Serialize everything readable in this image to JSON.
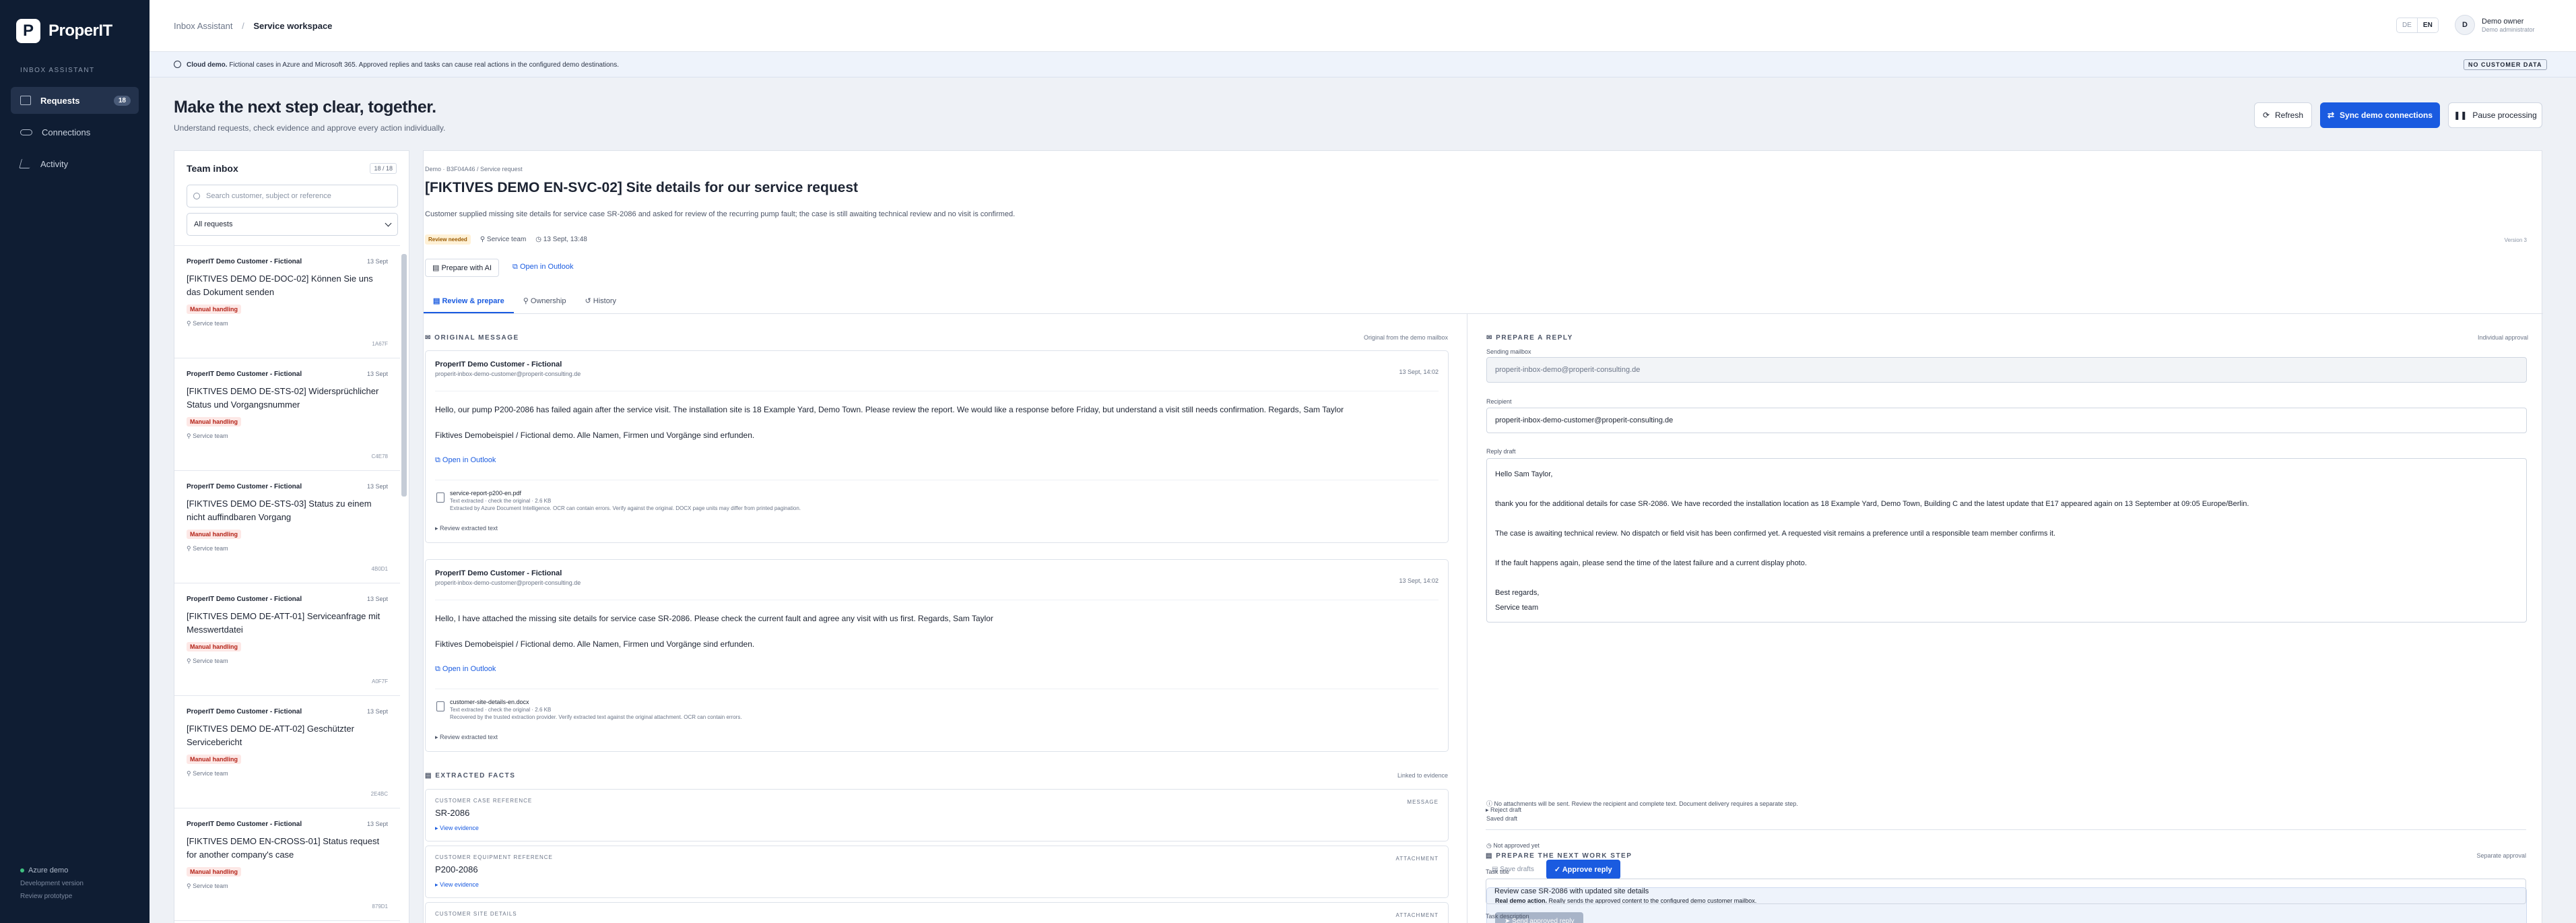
{
  "brand": {
    "mark": "P",
    "name": "ProperIT"
  },
  "nav": {
    "section_label": "INBOX ASSISTANT",
    "items": [
      {
        "label": "Requests",
        "badge": "18"
      },
      {
        "label": "Connections"
      },
      {
        "label": "Activity"
      }
    ],
    "footer": {
      "env": "Azure demo",
      "version": "Development version",
      "prototype": "Review prototype"
    }
  },
  "topbar": {
    "crumb_parent": "Inbox Assistant",
    "crumb_separator": "/",
    "crumb_current": "Service workspace",
    "lang_de": "DE",
    "lang_en": "EN",
    "user_initial": "D",
    "user_name": "Demo owner",
    "user_role": "Demo administrator"
  },
  "banner": {
    "strong": "Cloud demo.",
    "text": " Fictional cases in Azure and Microsoft 365. Approved replies and tasks can cause real actions in the configured demo destinations.",
    "tag": "NO CUSTOMER DATA"
  },
  "header": {
    "title": "Make the next step clear, together.",
    "subtitle": "Understand requests, check evidence and approve every action individually.",
    "refresh": "Refresh",
    "sync": "Sync demo connections",
    "pause": "Pause processing"
  },
  "inbox": {
    "title": "Team inbox",
    "count": "18 / 18",
    "search_placeholder": "Search customer, subject or reference",
    "filter": "All requests",
    "tickets": [
      {
        "customer": "ProperIT Demo Customer - Fictional",
        "date": "13 Sept",
        "title": "[FIKTIVES DEMO DE-DOC-02] Können Sie uns das Dokument senden",
        "badge": "Manual handling",
        "team": "Service team",
        "ref": "1A67F"
      },
      {
        "customer": "ProperIT Demo Customer - Fictional",
        "date": "13 Sept",
        "title": "[FIKTIVES DEMO DE-STS-02] Widersprüchlicher Status und Vorgangsnummer",
        "badge": "Manual handling",
        "team": "Service team",
        "ref": "C4E78"
      },
      {
        "customer": "ProperIT Demo Customer - Fictional",
        "date": "13 Sept",
        "title": "[FIKTIVES DEMO DE-STS-03] Status zu einem nicht auffindbaren Vorgang",
        "badge": "Manual handling",
        "team": "Service team",
        "ref": "4B0D1"
      },
      {
        "customer": "ProperIT Demo Customer - Fictional",
        "date": "13 Sept",
        "title": "[FIKTIVES DEMO DE-ATT-01] Serviceanfrage mit Messwertdatei",
        "badge": "Manual handling",
        "team": "Service team",
        "ref": "A0F7F"
      },
      {
        "customer": "ProperIT Demo Customer - Fictional",
        "date": "13 Sept",
        "title": "[FIKTIVES DEMO DE-ATT-02] Geschützter Servicebericht",
        "badge": "Manual handling",
        "team": "Service team",
        "ref": "2E4BC"
      },
      {
        "customer": "ProperIT Demo Customer - Fictional",
        "date": "13 Sept",
        "title": "[FIKTIVES DEMO EN-CROSS-01] Status request for another company's case",
        "badge": "Manual handling",
        "team": "Service team",
        "ref": "879D1"
      }
    ]
  },
  "detail": {
    "crumb": "Demo · B3F04A46  /  Service request",
    "title": "[FIKTIVES DEMO EN-SVC-02] Site details for our service request",
    "summary": "Customer supplied missing site details for service case SR-2086 and asked for review of the recurring pump fault; the case is still awaiting technical review and no visit is confirmed.",
    "status": "Review needed",
    "team": "Service team",
    "date": "13 Sept, 13:48",
    "version": "Version 3",
    "prepare_ai": "Prepare with AI",
    "open_outlook": "Open in Outlook",
    "tabs": [
      "Review & prepare",
      "Ownership",
      "History"
    ]
  },
  "original": {
    "heading": "ORIGINAL MESSAGE",
    "note": "Original from the demo mailbox",
    "messages": [
      {
        "from": "ProperIT Demo Customer - Fictional",
        "mail": "properit-inbox-demo-customer@properit-consulting.de",
        "date": "13 Sept, 14:02",
        "body": "Hello, our pump P200-2086 has failed again after the service visit. The installation site is 18 Example Yard, Demo Town. Please review the report. We would like a response before Friday, but understand a visit still needs confirmation. Regards, Sam Taylor",
        "body2": "Fiktives Demobeispiel / Fictional demo. Alle Namen, Firmen und Vorgänge sind erfunden.",
        "outlook": "Open in Outlook",
        "att_name": "service-report-p200-en.pdf",
        "att_note1": "Text extracted · check the original · 2.6 KB",
        "att_note2": "Extracted by Azure Document Intelligence. OCR can contain errors. Verify against the original. DOCX page units may differ from printed pagination.",
        "att_review": "▸  Review extracted text"
      },
      {
        "from": "ProperIT Demo Customer - Fictional",
        "mail": "properit-inbox-demo-customer@properit-consulting.de",
        "date": "13 Sept, 14:02",
        "body": "Hello, I have attached the missing site details for service case SR-2086. Please check the current fault and agree any visit with us first. Regards, Sam Taylor",
        "body2": "Fiktives Demobeispiel / Fictional demo. Alle Namen, Firmen und Vorgänge sind erfunden.",
        "outlook": "Open in Outlook",
        "att_name": "customer-site-details-en.docx",
        "att_note1": "Text extracted · check the original · 2.6 KB",
        "att_note2": "Recovered by the trusted extraction provider. Verify extracted text against the original attachment. OCR can contain errors.",
        "att_review": "▸  Review extracted text"
      }
    ]
  },
  "facts": {
    "heading": "EXTRACTED FACTS",
    "note": "Linked to evidence",
    "items": [
      {
        "label": "CUSTOMER CASE REFERENCE",
        "source": "MESSAGE",
        "value": "SR-2086",
        "evidence": "▸  View evidence"
      },
      {
        "label": "CUSTOMER EQUIPMENT REFERENCE",
        "source": "ATTACHMENT",
        "value": "P200-2086",
        "evidence": "▸  View evidence"
      },
      {
        "label": "CUSTOMER SITE DETAILS",
        "source": "ATTACHMENT",
        "value": "",
        "evidence": ""
      }
    ]
  },
  "reply": {
    "heading": "PREPARE A REPLY",
    "note": "Individual approval",
    "mailbox_label": "Sending mailbox",
    "mailbox": "properit-inbox-demo@properit-consulting.de",
    "recipient_label": "Recipient",
    "recipient": "properit-inbox-demo-customer@properit-consulting.de",
    "draft_label": "Reply draft",
    "draft": "Hello Sam Taylor,\n\nthank you for the additional details for case SR-2086. We have recorded the installation location as 18 Example Yard, Demo Town, Building C and the latest update that E17 appeared again on 13 September at 09:05 Europe/Berlin.\n\nThe case is awaiting technical review. No dispatch or field visit has been confirmed yet. A requested visit remains a preference until a responsible team member confirms it.\n\nIf the fault happens again, please send the time of the latest failure and a current display photo.\n\nBest regards,\nService team",
    "attach_note": "No attachments will be sent. Review the recipient and complete text. Document delivery requires a separate step.",
    "saved": "Saved draft",
    "not_approved": "Not approved yet",
    "save_drafts": "Save drafts",
    "approve": "Approve reply",
    "real_strong": "Real demo action.",
    "real_text": " Really sends the approved content to the configured demo customer mailbox.",
    "send": "Send approved reply",
    "reject": "▸  Reject draft"
  },
  "task": {
    "heading": "PREPARE THE NEXT WORK STEP",
    "note": "Separate approval",
    "title_label": "Task title",
    "title": "Review case SR-2086 with updated site details",
    "desc_label": "Task description"
  }
}
